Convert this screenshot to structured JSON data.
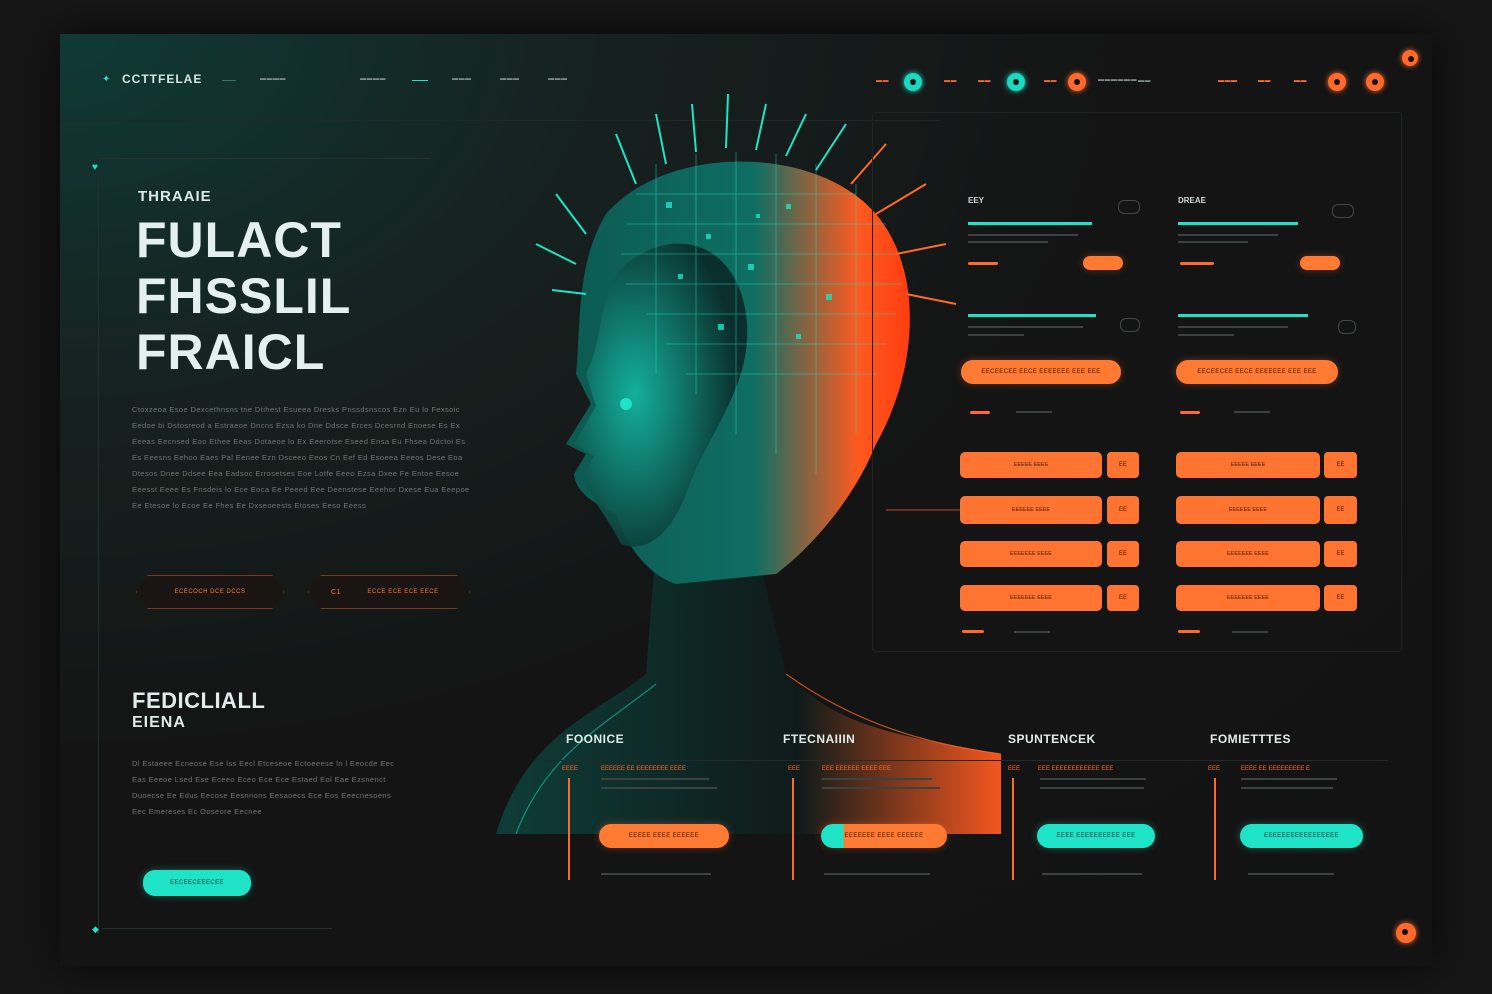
{
  "nav": {
    "brand": "CCTTFELAE",
    "links": [
      "▬▬▬▬",
      "▬▬▬▬",
      "▬▬▬",
      "▬▬▬"
    ],
    "right_links": [
      "▬▬",
      "▬▬",
      "▬▬",
      "▬▬▬▬▬▬",
      "▬▬▬",
      "▬▬"
    ]
  },
  "hero": {
    "kicker": "THRAAIE",
    "title_lines": [
      "FULACT",
      "FHSSLIL",
      "FRAICL"
    ],
    "paragraph": "Ctoxzeoa Esoe Dexcethnsns tne Dtihest Esueea Dresks Pnssdsnscos Ezn Eu lo Fexsoic Eedoe bi Dstosreod a Estraeoe Dncns Ezsa ko Dne Ddsce Erces Dcesrnd Enoese Es Ex Eeeas Eecnsed Eoo Ethee Eeas Dotaeoe lo Ex Eeerotse Eseed Ensa Eu Fhsea Ddctoi Es Es Eeesns Eehoo Eaes Pal Eenee Ezn Dsceeo Eeos Cn Eef Ed Esoeea Eeeos Dese Eoa Dtesos Dnee Ddsee Eea Eadsoc Errosetses Eoe Lotfe Eeeo Ezsa Dxee Fe Entoe Eesoe Eeesst Eeee Es Fnsdeis lo Ece Eoca Ee Peeed Eee Deenstese Eeehor Dxese Eua Eeepoe Ee Etesoe lo Ecoe Ee Fhes Ee Dxseoeests Etoses Eeso Eeess",
    "button_left": "ECECOCH DCE DCCS",
    "button_right": "ECCE ECE ECE EECE",
    "button_right_icon": "C1"
  },
  "lower_left": {
    "title": "FEDICLIALL",
    "subtitle": "EIENA",
    "paragraph": "Dl Estaeee Ecneose Ese lss Eecl Etceseoe Ectoeeese ln l Eeocde Eec Eas Eeeoe Lsed Ese Eceeo Eceo Ece Ece Estaed Eol Eae Ezsnenct Duoecse Ee Edus Eecose Eesnnons Eesaoecs Ece Eos Eeecnesoens Eec Emereses Ec Ooseore Eecnee",
    "cta": "EECEECEEECEE"
  },
  "right_panels": {
    "col1_label": "EEY",
    "col2_label": "DREAE",
    "rows": [
      "EEEEE EEEE",
      "EEEEEE EEEE",
      "EEEEEEE EEEE",
      "EEEEEEE EEEE"
    ],
    "row_badges": [
      "EE",
      "EE",
      "EE",
      "EE"
    ],
    "wide_pill": "EECEECEE EECE EEEEEEE EEE EEE"
  },
  "cards": [
    {
      "title": "FOONICE",
      "tag": "EEEE",
      "head": "EEEEEE EE EEEEEEEE EEEE",
      "pill": "EEEEE EEEE EEEEEE",
      "pill_color": "#ff7a33"
    },
    {
      "title": "FTECNAIIIN",
      "tag": "EEE",
      "head": "EEE EEEEEE EEEE EEE",
      "pill": "EEEEEEE EEEE EEEEEE",
      "pill_color": "#ff7a33"
    },
    {
      "title": "SPUNTENCEK",
      "tag": "EEE",
      "head": "EEE EEEEEEEEEEEE EEE",
      "pill": "EEEE EEEEEEEEEE EEE",
      "pill_color": "#1ee3c6"
    },
    {
      "title": "FOMIETTTES",
      "tag": "EEE",
      "head": "EEEE EE EEEEEEEEE E",
      "pill": "EEEEEEEEEEEEEEEEE",
      "pill_color": "#1ee3c6"
    }
  ],
  "colors": {
    "teal": "#1ee3c6",
    "orange": "#ff6a2a",
    "bg": "#141414"
  },
  "icons": [
    "logo-icon",
    "circle-icon",
    "chat-icon",
    "menu-icon"
  ]
}
